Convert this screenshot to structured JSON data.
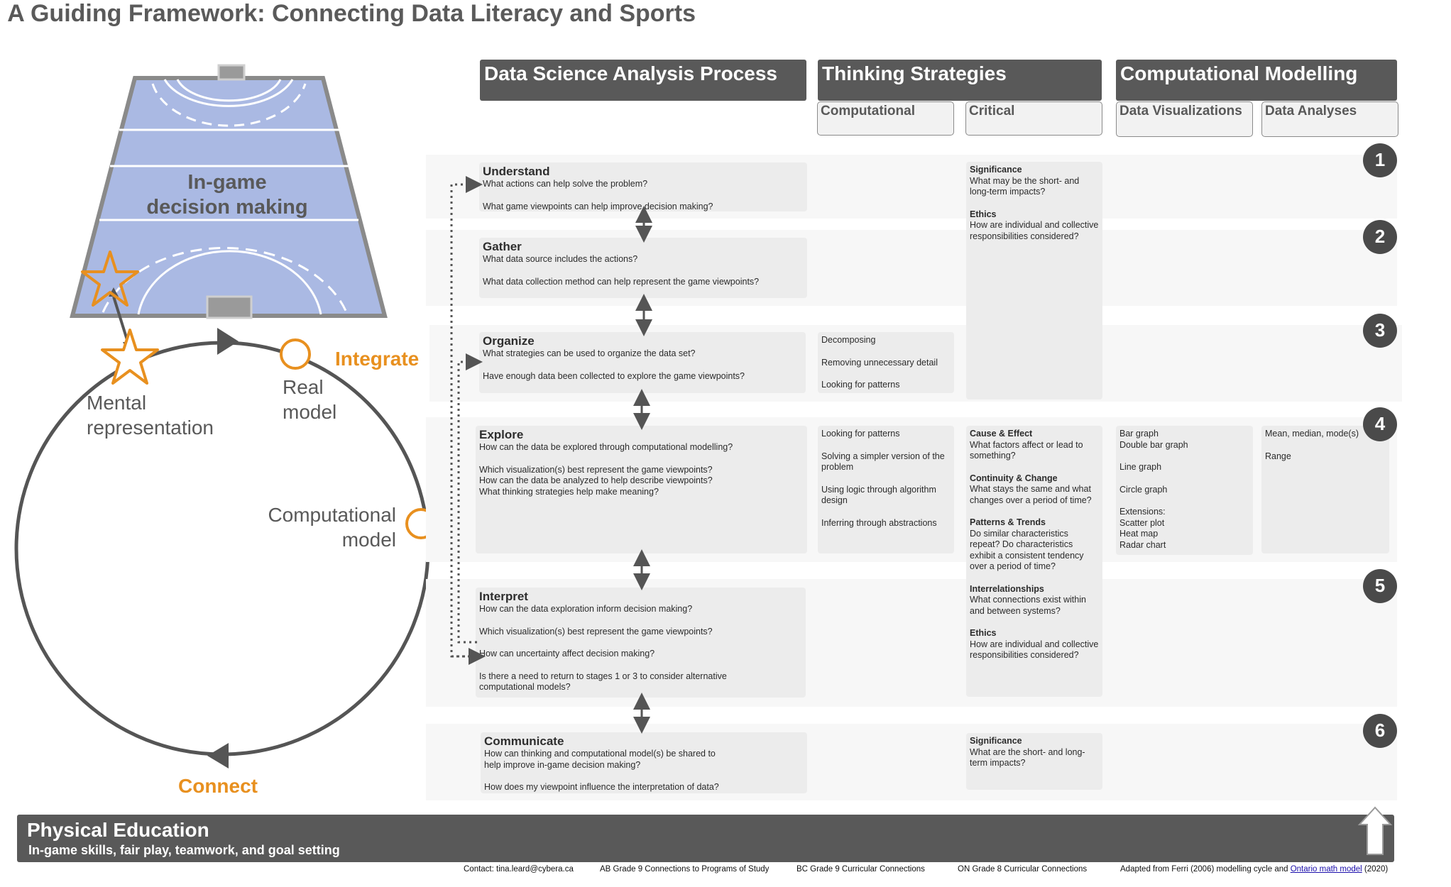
{
  "title": "A Guiding Framework: Connecting Data Literacy and Sports",
  "headers": {
    "process": "Data Science Analysis Process",
    "thinking": "Thinking Strategies",
    "thinking_sub1": "Computational",
    "thinking_sub2": "Critical",
    "modelling": "Computational Modelling",
    "modelling_sub1": "Data Visualizations",
    "modelling_sub2": "Data Analyses"
  },
  "left": {
    "court_label_line1": "In-game",
    "court_label_line2": "decision making",
    "integrate": "Integrate",
    "connect": "Connect",
    "real_model_1": "Real",
    "real_model_2": "model",
    "mental_1": "Mental",
    "mental_2": "representation",
    "computational_1": "Computational",
    "computational_2": "model"
  },
  "colors": {
    "accent": "#e8901f",
    "dark": "#595959",
    "court": "#aab9e3"
  },
  "stages": [
    {
      "num": "1",
      "title": "Understand",
      "questions": [
        "What actions can help solve the problem?",
        "What game viewpoints can help improve decision making?"
      ]
    },
    {
      "num": "2",
      "title": "Gather",
      "questions": [
        "What data source includes the actions?",
        "What data collection method can help represent the game viewpoints?"
      ]
    },
    {
      "num": "3",
      "title": "Organize",
      "questions": [
        "What strategies can be used to organize the data set?",
        "Have enough data been collected to explore the game viewpoints?"
      ]
    },
    {
      "num": "4",
      "title": "Explore",
      "questions": [
        "How can the data be explored through computational modelling?",
        "Which visualization(s) best represent the game viewpoints?",
        "How can the data be analyzed to help describe viewpoints?",
        "What thinking strategies help make meaning?"
      ]
    },
    {
      "num": "5",
      "title": "Interpret",
      "questions": [
        "How can the data exploration inform decision making?",
        "Which visualization(s) best represent the game viewpoints?",
        "How can uncertainty affect decision making?",
        "Is there a need to return to stages 1 or 3 to consider alternative computational models?"
      ]
    },
    {
      "num": "6",
      "title": "Communicate",
      "questions": [
        "How can thinking and computational model(s) be shared to help improve in-game decision making?",
        "How does my viewpoint influence the interpretation of data?"
      ]
    }
  ],
  "computational": {
    "organize": [
      "Decomposing",
      "Removing unnecessary detail",
      "Looking for patterns"
    ],
    "explore": [
      "Looking for patterns",
      "Solving a simpler version of the problem",
      "Using logic through algorithm design",
      "Inferring through abstractions"
    ]
  },
  "critical": {
    "top": [
      {
        "t": "Significance",
        "d": "What may be the short- and long-term impacts?"
      },
      {
        "t": "Ethics",
        "d": "How are individual and collective responsibilities considered?"
      }
    ],
    "middle": [
      {
        "t": "Cause & Effect",
        "d": "What factors affect or lead to something?"
      },
      {
        "t": "Continuity & Change",
        "d": "What stays the same and what changes over a period of time?"
      },
      {
        "t": "Patterns & Trends",
        "d": "Do similar characteristics repeat? Do characteristics exhibit a consistent tendency over a period of time?"
      },
      {
        "t": "Interrelationships",
        "d": "What connections exist within and between systems?"
      },
      {
        "t": "Ethics",
        "d": "How are individual and collective responsibilities considered?"
      }
    ],
    "bottom": [
      {
        "t": "Significance",
        "d": "What are the short- and long-term impacts?"
      }
    ]
  },
  "visualizations": [
    "Bar graph",
    "Double bar graph",
    "Line graph",
    "Circle graph",
    "Extensions:",
    "Scatter plot",
    "Heat map",
    "Radar chart"
  ],
  "analyses": [
    "Mean, median, mode(s)",
    "Range"
  ],
  "footer_bar": {
    "title": "Physical Education",
    "subtitle": "In-game skills, fair play, teamwork, and goal setting"
  },
  "footer_links": {
    "contact": "Contact: tina.leard@cybera.ca",
    "ab": "AB Grade 9 Connections to Programs of Study",
    "bc": "BC Grade 9 Curricular Connections",
    "on": "ON Grade 8 Curricular Connections",
    "adapted_pre": "Adapted from Ferri (2006) modelling cycle and",
    "adapted_link": "Ontario math model",
    "adapted_post": "(2020)"
  }
}
